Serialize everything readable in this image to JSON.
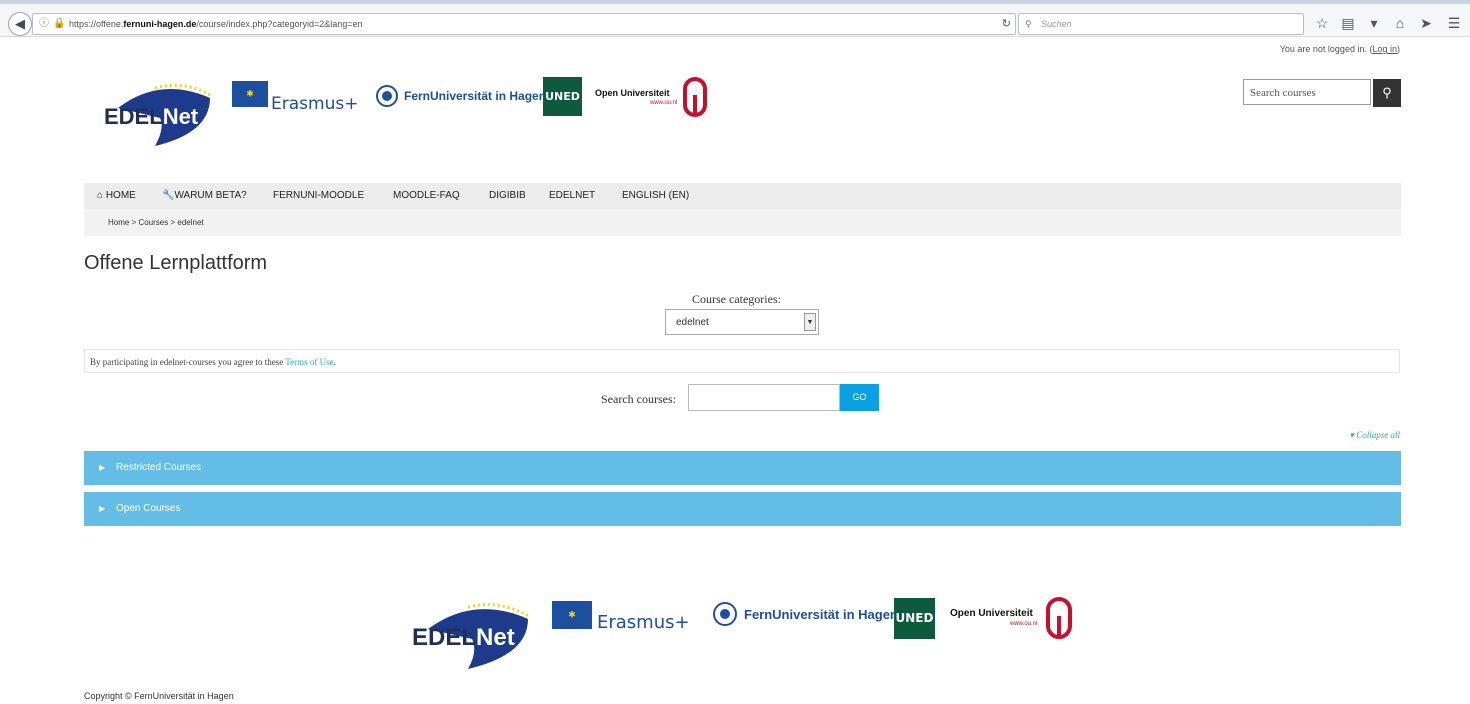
{
  "browser": {
    "url_prefix": "https://offene.",
    "url_domain": "fernuni-hagen.de",
    "url_path": "/course/index.php?categoryid=2&lang=en",
    "search_placeholder": "Suchen"
  },
  "login": {
    "text": "You are not logged in. (",
    "link": "Log in",
    "close": ")"
  },
  "logos": {
    "edelnet_a": "EDEL",
    "edelnet_b": "Net",
    "erasmus": "Erasmus+",
    "fernuni": "FernUniversität in Hagen",
    "uned": "UNED",
    "ou": "Open Universiteit",
    "ou_sub": "www.ou.nl"
  },
  "site_search": {
    "placeholder": "Search courses"
  },
  "nav": {
    "items": [
      "HOME",
      "WARUM BETA?",
      "FERNUNI-MOODLE",
      "MOODLE-FAQ",
      "DIGIBIB",
      "EDELNET",
      "ENGLISH (EN)"
    ]
  },
  "breadcrumb": "Home  >  Courses  >  edelnet",
  "page_title": "Offene Lernplattform",
  "categories": {
    "label": "Course categories:",
    "selected": "edelnet"
  },
  "terms": {
    "text": "By participating in edelnet-courses you agree to these ",
    "link": "Terms of Use",
    "end": "."
  },
  "course_search": {
    "label": "Search courses:",
    "button": "GO"
  },
  "collapse_all": "Collapse all",
  "course_categories": [
    "Restricted Courses",
    "Open Courses"
  ],
  "copyright": "Copyright © FernUniversität in Hagen",
  "colors": {
    "accent": "#63bde6",
    "go_button": "#0aa0e4",
    "link": "#29a8e0",
    "uned": "#0d5a3c",
    "ou_red": "#c8102e"
  }
}
